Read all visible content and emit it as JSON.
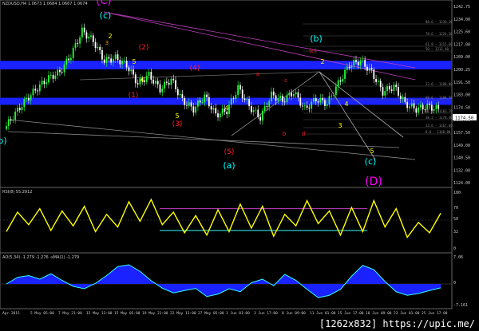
{
  "window": {
    "header": "NZDUSD,H4 1.0673 1.0684 1.0667 1.0674",
    "watermark": "[1262x832] https://upic.me/"
  },
  "chart_data": [
    {
      "type": "candlestick",
      "title": "NZDUSD,H4",
      "price_axis": [
        "1242.75",
        "1234.00",
        "1225.60",
        "1217.00",
        "1209.00",
        "1200.25",
        "1191.50",
        "1183.00",
        "1174.50",
        "1166.00",
        "1157.50",
        "1149.00",
        "1140.50",
        "1132.00",
        "1124.00"
      ],
      "ylim": [
        1120,
        1248
      ],
      "x_ticks": [
        "Apr 2015",
        "5 May 05:00",
        "7 May 21:00",
        "12 May 13:00",
        "15 May 05:00",
        "19 May 21:00",
        "22 May 13:00",
        "27 May 05:00",
        "1 Jun 01:00",
        "3 Jun 17:00",
        "8 Jun 09:00",
        "11 Jun 01:00",
        "15 Jun 17:00",
        "18 Jun 09:00",
        "23 Jun 01:00",
        "25 Jun 17:00"
      ],
      "price_path": [
        1160,
        1171,
        1181,
        1189,
        1196,
        1200,
        1212,
        1229,
        1222,
        1208,
        1210,
        1205,
        1192,
        1198,
        1188,
        1195,
        1180,
        1174,
        1183,
        1170,
        1173,
        1189,
        1176,
        1168,
        1184,
        1180,
        1186,
        1174,
        1181,
        1178,
        1192,
        1205,
        1208,
        1200,
        1186,
        1190,
        1178,
        1174,
        1176,
        1174
      ],
      "bands": [
        {
          "from": 1202,
          "to": 1208,
          "color": "#1a22ff"
        },
        {
          "from": 1177,
          "to": 1182,
          "color": "#1a22ff"
        }
      ],
      "fib_labels": [
        "88.6 - 1236.30",
        "78.6 - 1224.50",
        "61.8 - 1215.60",
        "50 - 1212.40",
        "23.6 - 1198.00",
        "88.6 - 1188.50",
        "61.8 - 1183.70",
        "38.2 - 1178.40",
        "23.6 - 1167.60",
        "0.0 - 1160.00"
      ],
      "wave_labels": [
        "(C)",
        "(c)",
        "2",
        "3",
        "4",
        "5",
        "1",
        "(1)",
        "(2)",
        "(3)",
        "(4)",
        "(5)",
        "(a)",
        "(b)",
        "(c)",
        "(d)",
        "(e)",
        "a",
        "b",
        "c",
        "d",
        "e",
        "(D)",
        "b)"
      ],
      "current_price": "1174.50"
    },
    {
      "type": "line",
      "title": "RSI(8) 55.2912",
      "name": "RSI(8)",
      "value": "55.2912",
      "levels": [
        "100",
        "70",
        "50",
        "32",
        "0"
      ],
      "ylim": [
        0,
        100
      ],
      "values": [
        30,
        64,
        42,
        70,
        32,
        66,
        40,
        74,
        30,
        60,
        38,
        82,
        48,
        86,
        42,
        64,
        28,
        58,
        24,
        68,
        30,
        78,
        36,
        74,
        22,
        60,
        40,
        84,
        44,
        66,
        24,
        72,
        30,
        84,
        38,
        70,
        20,
        46,
        28,
        62
      ]
    },
    {
      "type": "area",
      "title": "AO(5,34) -1.279 -1.276 -sMA(1) -1.279",
      "levels": [
        "7.06",
        "0",
        "-7.161"
      ],
      "ylim": [
        -8,
        8
      ],
      "values": [
        0,
        2.2,
        2.8,
        1.6,
        3.4,
        1.2,
        -0.8,
        -1.6,
        0.2,
        2.8,
        5.8,
        6.4,
        4.2,
        1.1,
        -1.4,
        -3.0,
        -2.2,
        -1.5,
        -4.2,
        -3.4,
        -1.6,
        -2.6,
        0.4,
        1.6,
        -0.6,
        3.2,
        1.2,
        -1.8,
        -4.6,
        -3.8,
        -1.8,
        2.6,
        6.2,
        4.8,
        0.8,
        -2.6,
        -3.8,
        -3.2,
        -2.2,
        -1.3
      ]
    }
  ]
}
